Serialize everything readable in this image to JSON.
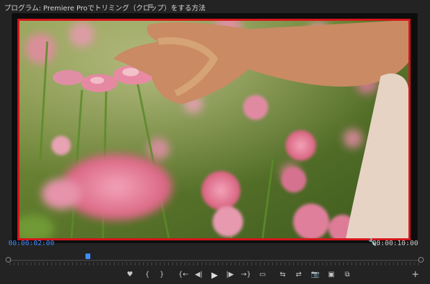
{
  "panel": {
    "title": "プログラム: Premiere Proでトリミング（クロップ）をする方法",
    "menu_glyph": "≡"
  },
  "timecode": {
    "current": "00:00:02:00",
    "duration": "00:00:10:00"
  },
  "playhead": {
    "position_fraction": 0.19
  },
  "overlay": {
    "crop_frame_color": "#d4151a"
  },
  "controls": {
    "marker": "♥",
    "mark_in": "{",
    "mark_out": "}",
    "go_to_in": "{←",
    "step_back": "◀|",
    "play": "▶",
    "step_forward": "|▶",
    "go_to_out": "→}",
    "safe_margins": "▭",
    "insert": "⇆",
    "overwrite": "⇄",
    "export_frame": "📷",
    "comparison_view": "▣",
    "vr_view": "⧉",
    "add_button": "+"
  },
  "colors": {
    "accent": "#3b8cff",
    "background": "#232323"
  }
}
